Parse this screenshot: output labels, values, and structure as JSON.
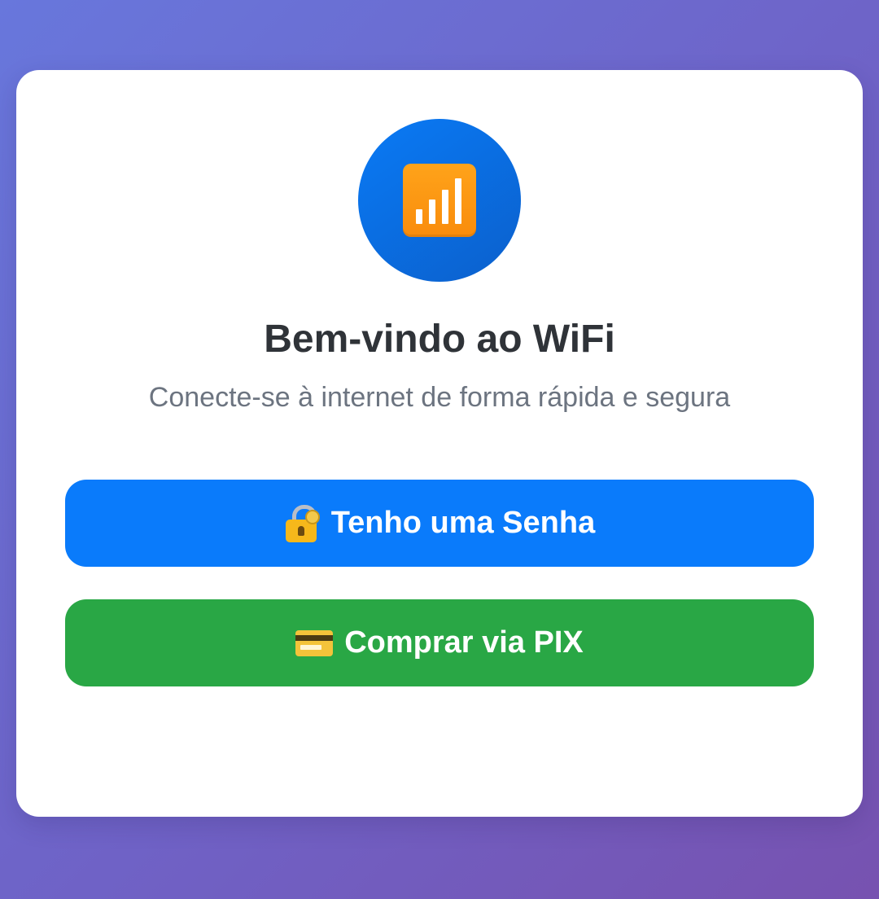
{
  "card": {
    "logo_icon": "signal-bars-icon",
    "title": "Bem-vindo ao WiFi",
    "subtitle": "Conecte-se à internet de forma rápida e segura"
  },
  "buttons": {
    "password": {
      "icon": "lock-with-key-icon",
      "label": "Tenho uma Senha",
      "color": "#0a7bfb"
    },
    "pix": {
      "icon": "credit-card-icon",
      "label": "Comprar via PIX",
      "color": "#29a745"
    }
  },
  "colors": {
    "background_start": "#6877dc",
    "background_end": "#7752b0",
    "logo_circle": "#0a7af5",
    "signal_tile": "#ffa31a"
  }
}
